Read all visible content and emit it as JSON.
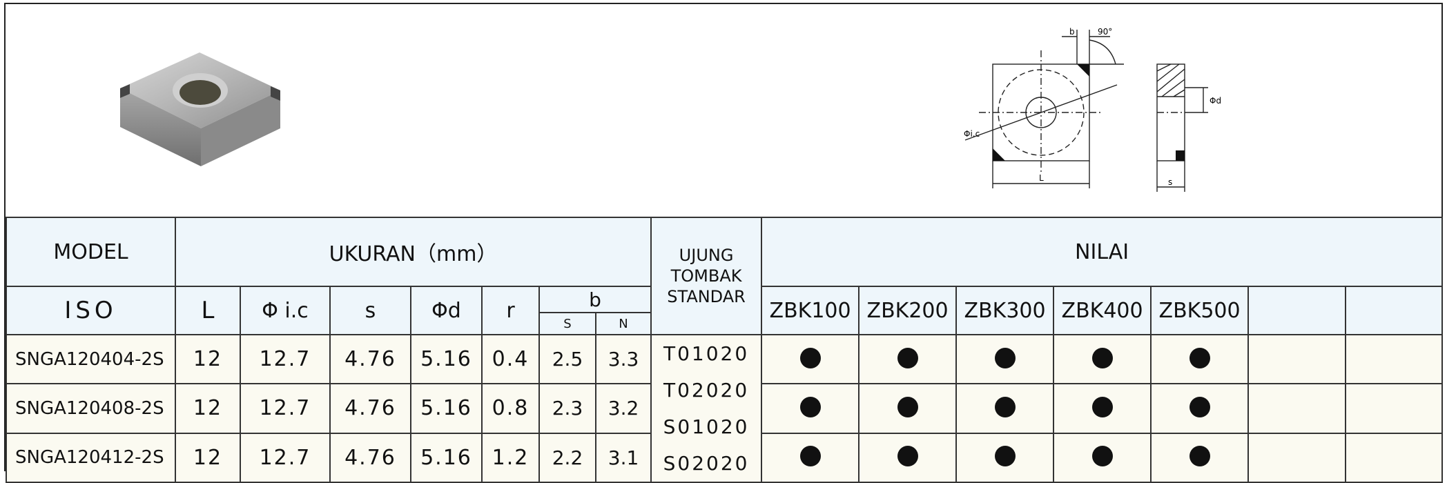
{
  "header": {
    "model_label": "MODEL",
    "size_label": "UKURAN（mm）",
    "tip_label": "UJUNG TOMBAK STANDAR",
    "value_label": "NILAI"
  },
  "subheader": {
    "iso": "ISO",
    "L": "L",
    "ic": "Φ i.c",
    "s": "s",
    "d": "Φd",
    "r": "r",
    "b": "b",
    "b_S": "S",
    "b_N": "N",
    "grades": [
      "ZBK100",
      "ZBK200",
      "ZBK300",
      "ZBK400",
      "ZBK500",
      "",
      ""
    ]
  },
  "rows": [
    {
      "model": "SNGA120404-2S",
      "L": "12",
      "ic": "12.7",
      "s": "4.76",
      "d": "5.16",
      "r": "0.4",
      "bS": "2.5",
      "bN": "3.3",
      "grades": [
        true,
        true,
        true,
        true,
        true,
        false,
        false
      ]
    },
    {
      "model": "SNGA120408-2S",
      "L": "12",
      "ic": "12.7",
      "s": "4.76",
      "d": "5.16",
      "r": "0.8",
      "bS": "2.3",
      "bN": "3.2",
      "grades": [
        true,
        true,
        true,
        true,
        true,
        false,
        false
      ]
    },
    {
      "model": "SNGA120412-2S",
      "L": "12",
      "ic": "12.7",
      "s": "4.76",
      "d": "5.16",
      "r": "1.2",
      "bS": "2.2",
      "bN": "3.1",
      "grades": [
        true,
        true,
        true,
        true,
        true,
        false,
        false
      ]
    }
  ],
  "tips": [
    "T01020",
    "T02020",
    "S01020",
    "S02020"
  ],
  "drawing": {
    "angle_label": "90°",
    "b_label": "b",
    "ic_label": "Φi.c",
    "d_label": "Φd",
    "L_label": "L",
    "s_label": "s"
  }
}
